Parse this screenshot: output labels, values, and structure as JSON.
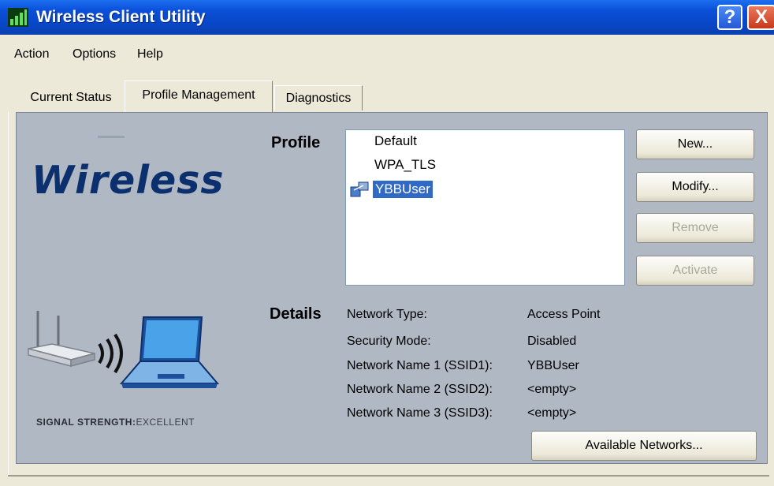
{
  "window": {
    "title": "Wireless Client Utility"
  },
  "titlebar_buttons": {
    "help": "?",
    "close": "X"
  },
  "menu": [
    "Action",
    "Options",
    "Help"
  ],
  "tabs": [
    {
      "label": "Current Status",
      "active": false
    },
    {
      "label": "Profile Management",
      "active": true
    },
    {
      "label": "Diagnostics",
      "active": false
    }
  ],
  "branding": {
    "logo_text": "Wireless",
    "signal_label": "SIGNAL STRENGTH:",
    "signal_value": "EXCELLENT"
  },
  "profile": {
    "label": "Profile",
    "items": [
      {
        "name": "Default",
        "selected": false
      },
      {
        "name": "WPA_TLS",
        "selected": false
      },
      {
        "name": "YBBUser",
        "selected": true
      }
    ]
  },
  "buttons": {
    "new": "New...",
    "modify": "Modify...",
    "remove": "Remove",
    "activate": "Activate",
    "available_networks": "Available Networks..."
  },
  "details": {
    "label": "Details",
    "rows": [
      {
        "key": "Network Type:",
        "value": "Access Point"
      },
      {
        "key": "Security Mode:",
        "value": "Disabled"
      },
      {
        "key": "Network Name 1 (SSID1):",
        "value": "YBBUser"
      },
      {
        "key": "Network Name 2 (SSID2):",
        "value": "<empty>"
      },
      {
        "key": "Network Name 3 (SSID3):",
        "value": "<empty>"
      }
    ]
  },
  "colors": {
    "titlebar": "#0a4fd8",
    "panel": "#b0b8c4",
    "selection": "#316ac5",
    "logo": "#0c2f6d"
  }
}
